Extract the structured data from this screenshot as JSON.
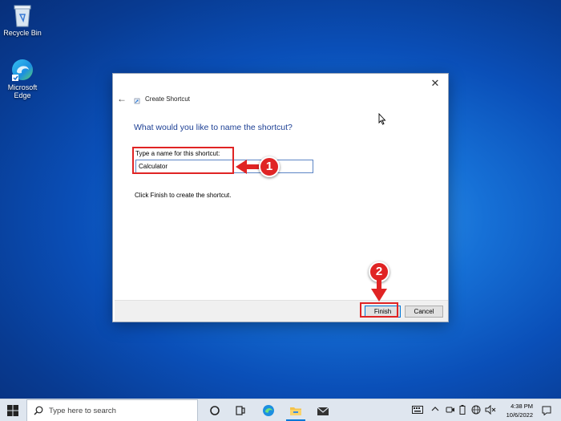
{
  "desktop": {
    "icons": [
      {
        "label": "Recycle Bin"
      },
      {
        "label": "Microsoft Edge"
      }
    ]
  },
  "dialog": {
    "title": "Create Shortcut",
    "close_label": "✕",
    "back_label": "←",
    "heading": "What would you like to name the shortcut?",
    "field_label": "Type a name for this shortcut:",
    "field_value": "Calculator",
    "hint": "Click Finish to create the shortcut.",
    "buttons": {
      "finish": "Finish",
      "cancel": "Cancel"
    }
  },
  "annotations": {
    "step1": "1",
    "step2": "2",
    "color": "#e02424"
  },
  "taskbar": {
    "search_placeholder": "Type here to search",
    "apps": [
      "task-view",
      "edge",
      "file-explorer",
      "mail"
    ],
    "clock": {
      "time": "4:38 PM",
      "date": "10/6/2022"
    }
  },
  "colors": {
    "accent": "#0078d7",
    "heading": "#1c3f94",
    "desktop": "#0a4fb8"
  }
}
